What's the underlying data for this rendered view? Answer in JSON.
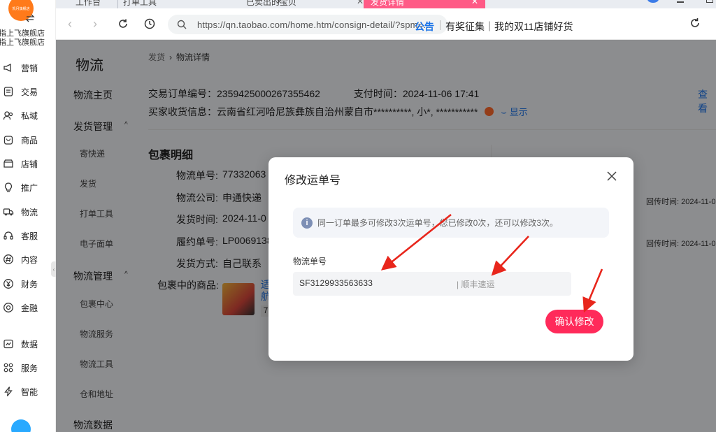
{
  "browser": {
    "tabs": [
      {
        "label": "工作台"
      },
      {
        "label": "打单工具"
      },
      {
        "label": "已卖出的宝贝"
      },
      {
        "label": "发货详情"
      }
    ],
    "url": "https://qn.taobao.com/home.htm/consign-detail/?spm=...",
    "announcement_label": "公告",
    "announcement_text": "有奖征集｜我的双11店铺好货"
  },
  "sidebar": {
    "logo_text": "凯月旗舰店",
    "shop_name_1": "指上飞旗舰店",
    "shop_name_2": "指上飞旗舰店",
    "items": [
      {
        "label": "营销",
        "icon": "megaphone-icon"
      },
      {
        "label": "交易",
        "icon": "receipt-icon"
      },
      {
        "label": "私域",
        "icon": "users-icon"
      },
      {
        "label": "商品",
        "icon": "bag-icon"
      },
      {
        "label": "店铺",
        "icon": "store-icon"
      },
      {
        "label": "推广",
        "icon": "bulb-icon"
      },
      {
        "label": "物流",
        "icon": "truck-icon"
      },
      {
        "label": "客服",
        "icon": "headset-icon"
      },
      {
        "label": "内容",
        "icon": "hash-icon"
      },
      {
        "label": "财务",
        "icon": "yen-icon"
      },
      {
        "label": "金融",
        "icon": "finance-icon"
      },
      {
        "label": "数据",
        "icon": "chart-icon"
      },
      {
        "label": "服务",
        "icon": "grid-icon"
      },
      {
        "label": "智能",
        "icon": "lightning-icon"
      }
    ]
  },
  "subnav": {
    "title": "物流",
    "home": "物流主页",
    "group1": "发货管理",
    "group1_items": [
      "寄快递",
      "发货",
      "打单工具",
      "电子面单"
    ],
    "group2": "物流管理",
    "group2_items": [
      "包裹中心",
      "物流服务",
      "物流工具",
      "仓和地址"
    ],
    "group3": "物流数据"
  },
  "main": {
    "breadcrumb": [
      "发货",
      "物流详情"
    ],
    "order_label": "交易订单编号：",
    "order_no": "2359425000267355462",
    "pay_label": "支付时间：",
    "pay_time": "2024-11-06 17:41",
    "view_link": "查看",
    "buyer_label": "买家收货信息：",
    "buyer_info": "云南省红河哈尼族彝族自治州蒙自市**********, 小*, ***********",
    "show_label": "显示",
    "package_title": "包裹明细",
    "package": [
      {
        "label": "物流单号:",
        "value": "77332063"
      },
      {
        "label": "物流公司:",
        "value": "申通快递"
      },
      {
        "label": "发货时间:",
        "value": "2024-11-0"
      },
      {
        "label": "履约单号:",
        "value": "LP0069138"
      },
      {
        "label": "发货方式:",
        "value": "自己联系"
      }
    ],
    "goods_label": "包裹中的商品:",
    "goods_text_1": "适",
    "goods_text_2": "航",
    "goods_qty": "7",
    "huichuan_1": "回传时间: 2024-11-0",
    "huichuan_2": "回传时间: 2024-11-0"
  },
  "modal": {
    "title": "修改运单号",
    "notice": "同一订单最多可修改3次运单号，您已修改0次，还可以修改3次。",
    "field_label": "物流单号",
    "tracking_no": "SF3129933563633",
    "company": "| 顺丰速运",
    "confirm_label": "确认修改"
  },
  "colors": {
    "accent": "#ff2a5a",
    "tab_active": "#ff5a86",
    "link": "#1a73e8",
    "annotation_arrow": "#e8261c"
  }
}
